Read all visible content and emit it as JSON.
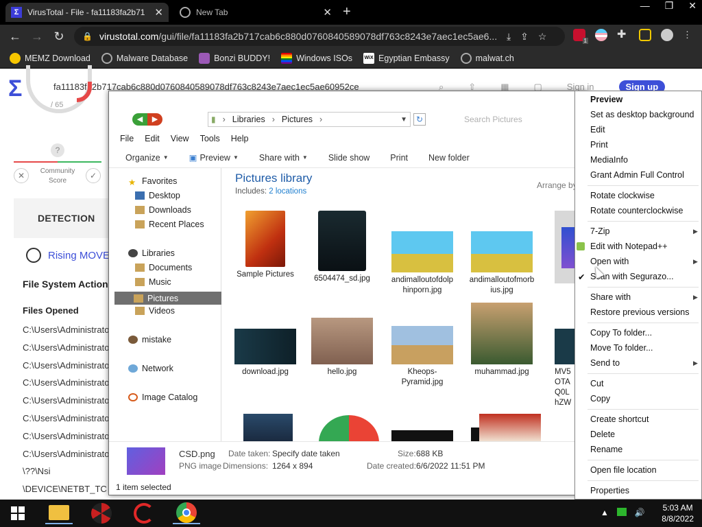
{
  "browser": {
    "tabs": [
      {
        "title": "VirusTotal - File - fa11183fa2b71",
        "active": true
      },
      {
        "title": "New Tab",
        "active": false
      }
    ],
    "window_controls": [
      "—",
      "❐",
      "✕"
    ],
    "url_host": "virustotal.com",
    "url_path": "/gui/file/fa11183fa2b717cab6c880d0760840589078df763c8243e7aec1ec5ae6...",
    "extension_badge": "1",
    "bookmarks": [
      "MEMZ Download",
      "Malware Database",
      "Bonzi BUDDY!",
      "Windows ISOs",
      "Egyptian Embassy",
      "malwat.ch"
    ]
  },
  "virustotal": {
    "search_text": "fa11183fa2b717cab6c880d0760840589078df763c8243e7aec1ec5ae60952ce",
    "gauge_text": "/ 65",
    "community_score_label": "Community Score",
    "question": "?",
    "sign_in": "Sign in",
    "sign_up": "Sign up",
    "detection_tab": "DETECTION",
    "rising_label": "Rising MOVE",
    "file_system_actions": "File System Action",
    "files_opened": "Files Opened",
    "paths": [
      "C:\\Users\\Administrato",
      "C:\\Users\\Administrato",
      "C:\\Users\\Administrato",
      "C:\\Users\\Administrato",
      "C:\\Users\\Administrato",
      "C:\\Users\\Administrato",
      "C:\\Users\\Administrato",
      "C:\\Users\\Administrato",
      "\\??\\Nsi",
      "\\DEVICE\\NETBT_TC"
    ]
  },
  "explorer": {
    "address": [
      "Libraries",
      "Pictures"
    ],
    "search_placeholder": "Search Pictures",
    "menu": [
      "File",
      "Edit",
      "View",
      "Tools",
      "Help"
    ],
    "commands": [
      "Organize",
      "Preview",
      "Share with",
      "Slide show",
      "Print",
      "New folder"
    ],
    "nav": {
      "favorites": "Favorites",
      "fav_items": [
        "Desktop",
        "Downloads",
        "Recent Places"
      ],
      "libraries": "Libraries",
      "lib_items": [
        "Documents",
        "Music",
        "Pictures",
        "Videos"
      ],
      "mistake": "mistake",
      "network": "Network",
      "image_catalog": "Image Catalog"
    },
    "library_title": "Pictures library",
    "includes_label": "Includes:",
    "includes_link": "2 locations",
    "arrange_by": "Arrange by",
    "files": [
      {
        "name": "Sample Pictures"
      },
      {
        "name": "6504474_sd.jpg"
      },
      {
        "name": "andimalloutofdolphinporn.jpg"
      },
      {
        "name": "andimalloutofmorbius.jpg"
      },
      {
        "name": "download.jpg"
      },
      {
        "name": "hello.jpg"
      },
      {
        "name": "Kheops-Pyramid.jpg"
      },
      {
        "name": "muhammad.jpg"
      },
      {
        "name": "MV5 OTA Q0L hZW"
      }
    ],
    "details": {
      "name": "CSD.png",
      "type": "PNG image",
      "date_taken_label": "Date taken:",
      "date_taken": "Specify date taken",
      "dimensions_label": "Dimensions:",
      "dimensions": "1264 x 894",
      "size_label": "Size:",
      "size": "688 KB",
      "date_created_label": "Date created:",
      "date_created": "6/6/2022 11:51 PM"
    },
    "selection_status": "1 item selected"
  },
  "context_menu": {
    "items": [
      "Preview",
      "Set as desktop background",
      "Edit",
      "Print",
      "MediaInfo",
      "Grant Admin Full Control",
      "Rotate clockwise",
      "Rotate counterclockwise",
      "7-Zip",
      "Edit with Notepad++",
      "Open with",
      "Scan with Segurazo...",
      "Share with",
      "Restore previous versions",
      "Copy To folder...",
      "Move To folder...",
      "Send to",
      "Cut",
      "Copy",
      "Create shortcut",
      "Delete",
      "Rename",
      "Open file location",
      "Properties"
    ]
  },
  "taskbar": {
    "time": "5:03 AM",
    "date": "8/8/2022"
  },
  "colors": {
    "accent_vt": "#3d4fd8",
    "selection_gray": "#6f6f6f",
    "library_title": "#1f5ca8"
  }
}
